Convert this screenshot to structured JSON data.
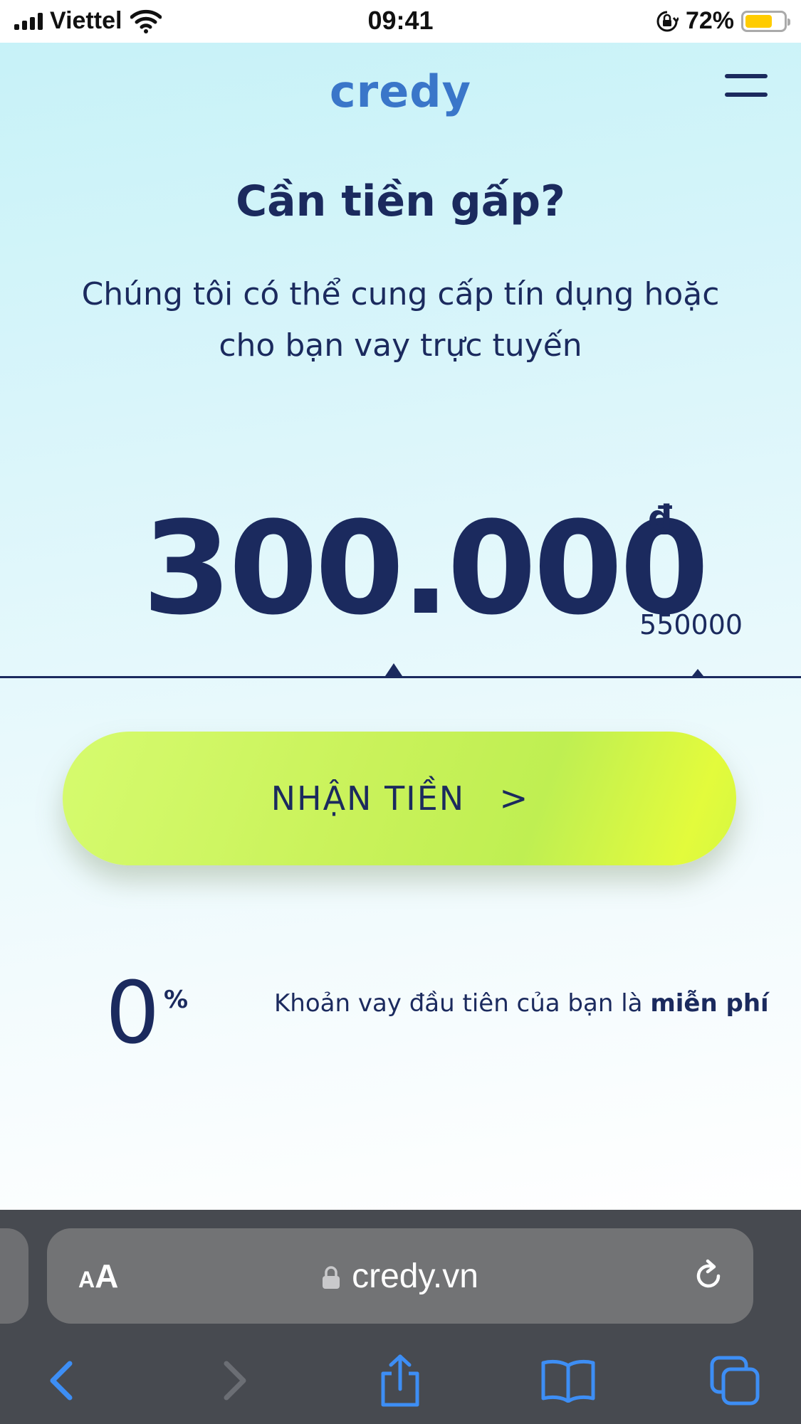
{
  "status_bar": {
    "carrier": "Viettel",
    "time": "09:41",
    "battery_percent": "72%",
    "battery_level": 0.72,
    "icons": [
      "signal-icon",
      "wifi-icon",
      "rotation-lock-icon",
      "battery-icon"
    ]
  },
  "header": {
    "logo": "credy",
    "menu_icon": "hamburger-menu-icon"
  },
  "hero": {
    "headline": "Cần tiền gấp?",
    "subtitle_line1": "Chúng tôi có thể cung cấp tín dụng hoặc",
    "subtitle_line2": "cho bạn vay trực tuyến"
  },
  "loan": {
    "amount": "300.000",
    "currency": "đ",
    "max_amount": "550000",
    "slider_value": 300000,
    "slider_max": 550000
  },
  "cta": {
    "label": "NHẬN TIỀN",
    "arrow": ">"
  },
  "promo": {
    "rate_value": "0",
    "rate_unit": "%",
    "text_prefix": "Khoản vay đầu tiên của bạn là",
    "text_emphasis": "miễn phí"
  },
  "safari": {
    "aa_small": "A",
    "aa_big": "A",
    "url": "credy.vn",
    "icons": [
      "padlock-icon",
      "reload-icon",
      "back-icon",
      "forward-icon",
      "share-icon",
      "bookmarks-icon",
      "tabs-icon"
    ]
  },
  "colors": {
    "brand_blue": "#3a76c9",
    "navy": "#1b2a5e",
    "cta_green": "#c9f25a",
    "safari_bar": "#474a50",
    "safari_accent": "#3d8ef5"
  }
}
